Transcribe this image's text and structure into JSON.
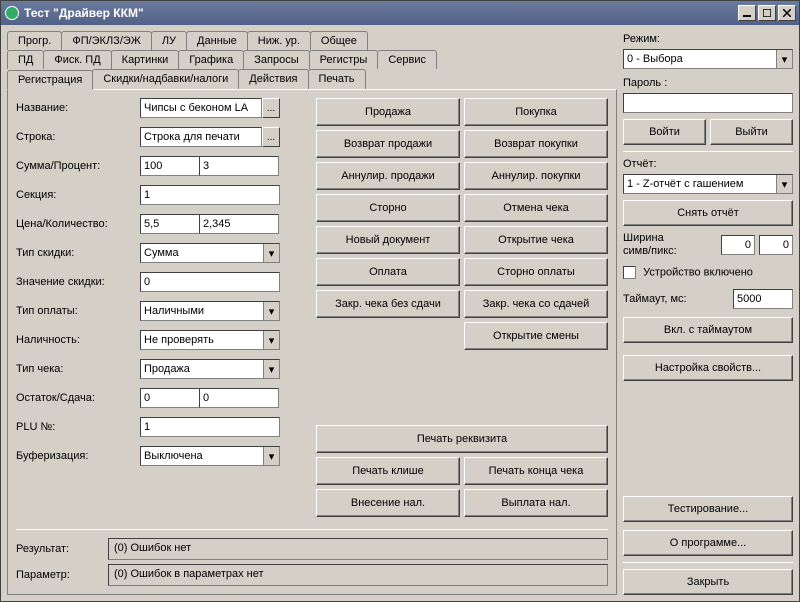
{
  "window": {
    "title": "Тест \"Драйвер ККМ\""
  },
  "tabs_row1": [
    "Прогр.",
    "ФП/ЭКЛЗ/ЭЖ",
    "ЛУ",
    "Данные",
    "Ниж. ур.",
    "Общее"
  ],
  "tabs_row2": [
    "ПД",
    "Фиск. ПД",
    "Картинки",
    "Графика",
    "Запросы",
    "Регистры",
    "Сервис"
  ],
  "tabs_row3": [
    "Регистрация",
    "Скидки/надбавки/налоги",
    "Действия",
    "Печать"
  ],
  "fields": {
    "name_lbl": "Название:",
    "name_val": "Чипсы с беконом LA",
    "line_lbl": "Строка:",
    "line_val": "Строка для печати",
    "sum_lbl": "Сумма/Процент:",
    "sum_val1": "100",
    "sum_val2": "3",
    "section_lbl": "Секция:",
    "section_val": "1",
    "price_lbl": "Цена/Количество:",
    "price_val1": "5,5",
    "price_val2": "2,345",
    "disc_type_lbl": "Тип скидки:",
    "disc_type_val": "Сумма",
    "disc_val_lbl": "Значение скидки:",
    "disc_val": "0",
    "pay_type_lbl": "Тип оплаты:",
    "pay_type_val": "Наличными",
    "cash_lbl": "Наличность:",
    "cash_val": "Не проверять",
    "check_type_lbl": "Тип чека:",
    "check_type_val": "Продажа",
    "rest_lbl": "Остаток/Сдача:",
    "rest_val1": "0",
    "rest_val2": "0",
    "plu_lbl": "PLU №:",
    "plu_val": "1",
    "buf_lbl": "Буферизация:",
    "buf_val": "Выключена"
  },
  "buttons_col1": [
    "Продажа",
    "Возврат продажи",
    "Аннулир. продажи",
    "Сторно",
    "Новый документ",
    "Оплата",
    "Закр. чека без сдачи"
  ],
  "buttons_col2": [
    "Покупка",
    "Возврат покупки",
    "Аннулир. покупки",
    "Отмена чека",
    "Открытие чека",
    "Сторно оплаты",
    "Закр. чека со сдачей",
    "Открытие смены"
  ],
  "wide_buttons": [
    {
      "l": "Печать реквизита",
      "r": null
    },
    {
      "l": "Печать клише",
      "r": "Печать конца чека"
    },
    {
      "l": "Внесение нал.",
      "r": "Выплата нал."
    }
  ],
  "status": {
    "result_lbl": "Результат:",
    "result_val": "(0) Ошибок нет",
    "param_lbl": "Параметр:",
    "param_val": "(0) Ошибок в параметрах нет"
  },
  "right": {
    "mode_lbl": "Режим:",
    "mode_val": "0 - Выбора",
    "pass_lbl": "Пароль :",
    "pass_val": "",
    "login": "Войти",
    "logout": "Выйти",
    "report_lbl": "Отчёт:",
    "report_val": "1 - Z-отчёт с гашением",
    "snap": "Снять отчёт",
    "width_lbl": "Ширина\nсимв/пикс:",
    "width_v1": "0",
    "width_v2": "0",
    "device_on": "Устройство включено",
    "timeout_lbl": "Таймаут, мс:",
    "timeout_val": "5000",
    "on_timeout": "Вкл. с таймаутом",
    "props": "Настройка свойств...",
    "test": "Тестирование...",
    "about": "О программе...",
    "close": "Закрыть"
  }
}
